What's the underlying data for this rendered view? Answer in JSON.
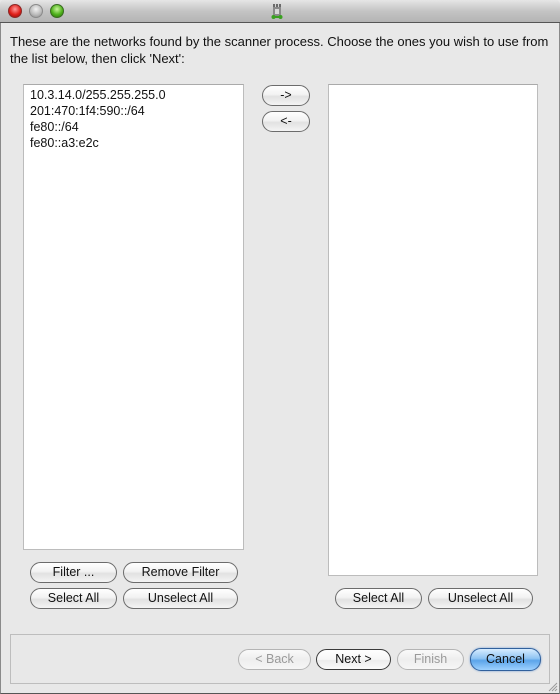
{
  "window": {
    "title": "",
    "app_icon": "rook-tower-icon"
  },
  "instructions": "These are the networks found by the scanner process. Choose the ones you wish to use from the list below, then click 'Next':",
  "available_networks": [
    "10.3.14.0/255.255.255.0",
    "201:470:1f4:590::/64",
    "fe80::/64",
    "fe80::a3:e2c"
  ],
  "selected_networks": [],
  "transfer": {
    "add_label": "->",
    "remove_label": "<-"
  },
  "left_buttons": {
    "filter": "Filter ...",
    "remove_filter": "Remove Filter",
    "select_all": "Select All",
    "unselect_all": "Unselect All"
  },
  "right_buttons": {
    "select_all": "Select All",
    "unselect_all": "Unselect All"
  },
  "wizard": {
    "back": "< Back",
    "next": "Next >",
    "finish": "Finish",
    "cancel": "Cancel",
    "back_enabled": false,
    "finish_enabled": false
  }
}
